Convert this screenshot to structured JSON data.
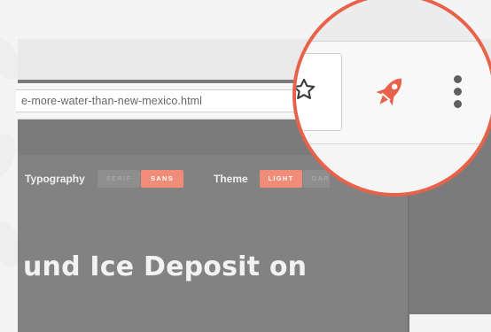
{
  "browser": {
    "url": "e-more-water-than-new-mexico.html"
  },
  "reader_settings": {
    "typography_label": "Typography",
    "typography_options": [
      "SERIF",
      "SANS"
    ],
    "typography_selected": "SANS",
    "theme_label": "Theme",
    "theme_options": [
      "LIGHT",
      "DAR"
    ],
    "theme_selected": "LIGHT"
  },
  "article": {
    "headline": "und Ice Deposit on"
  },
  "magnifier": {
    "icons": [
      "star-icon",
      "rocket-icon",
      "menu-icon"
    ]
  },
  "colors": {
    "accent": "#e8614a",
    "toggle_on": "#f08c78",
    "overlay": "#7b7b7b"
  }
}
